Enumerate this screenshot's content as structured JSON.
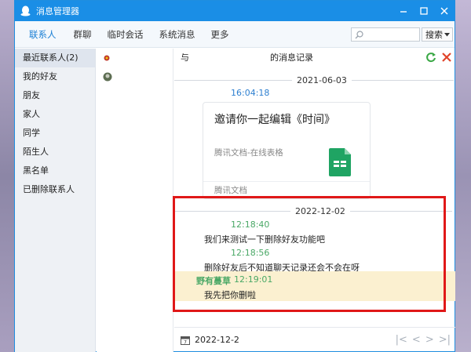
{
  "window": {
    "title": "消息管理器"
  },
  "toolbar": {
    "tabs": [
      "联系人",
      "群聊",
      "临时会话",
      "系统消息",
      "更多"
    ],
    "search_placeholder": "",
    "search_button": "搜索"
  },
  "left_nav": {
    "items": [
      "最近联系人(2)",
      "我的好友",
      "朋友",
      "家人",
      "同学",
      "陌生人",
      "黑名单",
      "已删除联系人"
    ]
  },
  "record": {
    "header_prefix": "与",
    "header_title": "的消息记录"
  },
  "messages": {
    "date1": "2021-06-03",
    "time1": "16:04:18",
    "card_title": "邀请你一起编辑《时间》",
    "card_sub": "腾讯文档-在线表格",
    "card_footer": "腾讯文档",
    "date2": "2022-12-02",
    "time2": "12:18:40",
    "text2": "我们来测试一下删除好友功能吧",
    "time3": "12:18:56",
    "text3": "删除好友后不知道聊天记录还会不会在呀",
    "sender4": "野有蔓草",
    "time4": "12:19:01",
    "text4": "我先把你删啦"
  },
  "bottombar": {
    "date": "2022-12-2"
  },
  "colors": {
    "accent": "#1a8ee6",
    "highlight_box": "#e01818",
    "time_blue": "#2d7fd0",
    "time_green": "#4aa866"
  }
}
